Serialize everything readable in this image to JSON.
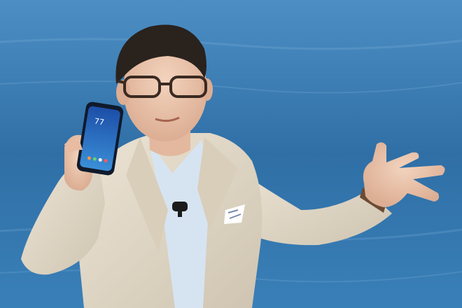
{
  "photo": {
    "background_color": "#2f6fa6",
    "phone": {
      "clock": "77"
    }
  }
}
